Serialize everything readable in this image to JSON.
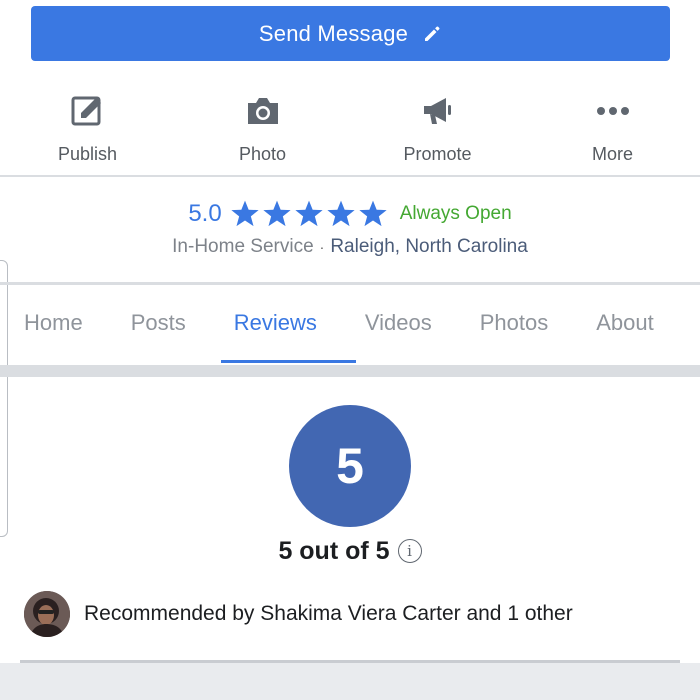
{
  "send_button": {
    "label": "Send Message",
    "icon": "pencil-icon",
    "color": "#3a78e2"
  },
  "actions": [
    {
      "label": "Publish",
      "icon": "edit-icon"
    },
    {
      "label": "Photo",
      "icon": "camera-icon"
    },
    {
      "label": "Promote",
      "icon": "megaphone-icon"
    },
    {
      "label": "More",
      "icon": "more-icon"
    }
  ],
  "rating": {
    "value": "5.0",
    "stars": 5,
    "status": "Always Open",
    "status_color": "#44a832",
    "category": "In-Home Service",
    "separator": "·",
    "location": "Raleigh, North Carolina"
  },
  "tabs": [
    {
      "label": "Home",
      "active": false
    },
    {
      "label": "Posts",
      "active": false
    },
    {
      "label": "Reviews",
      "active": true
    },
    {
      "label": "Videos",
      "active": false
    },
    {
      "label": "Photos",
      "active": false
    },
    {
      "label": "About",
      "active": false
    }
  ],
  "reviews": {
    "score": "5",
    "score_text": "5 out of 5",
    "info_glyph": "i",
    "circle_color": "#4267b2",
    "recommendation": "Recommended by Shakima Viera Carter and 1 other"
  }
}
